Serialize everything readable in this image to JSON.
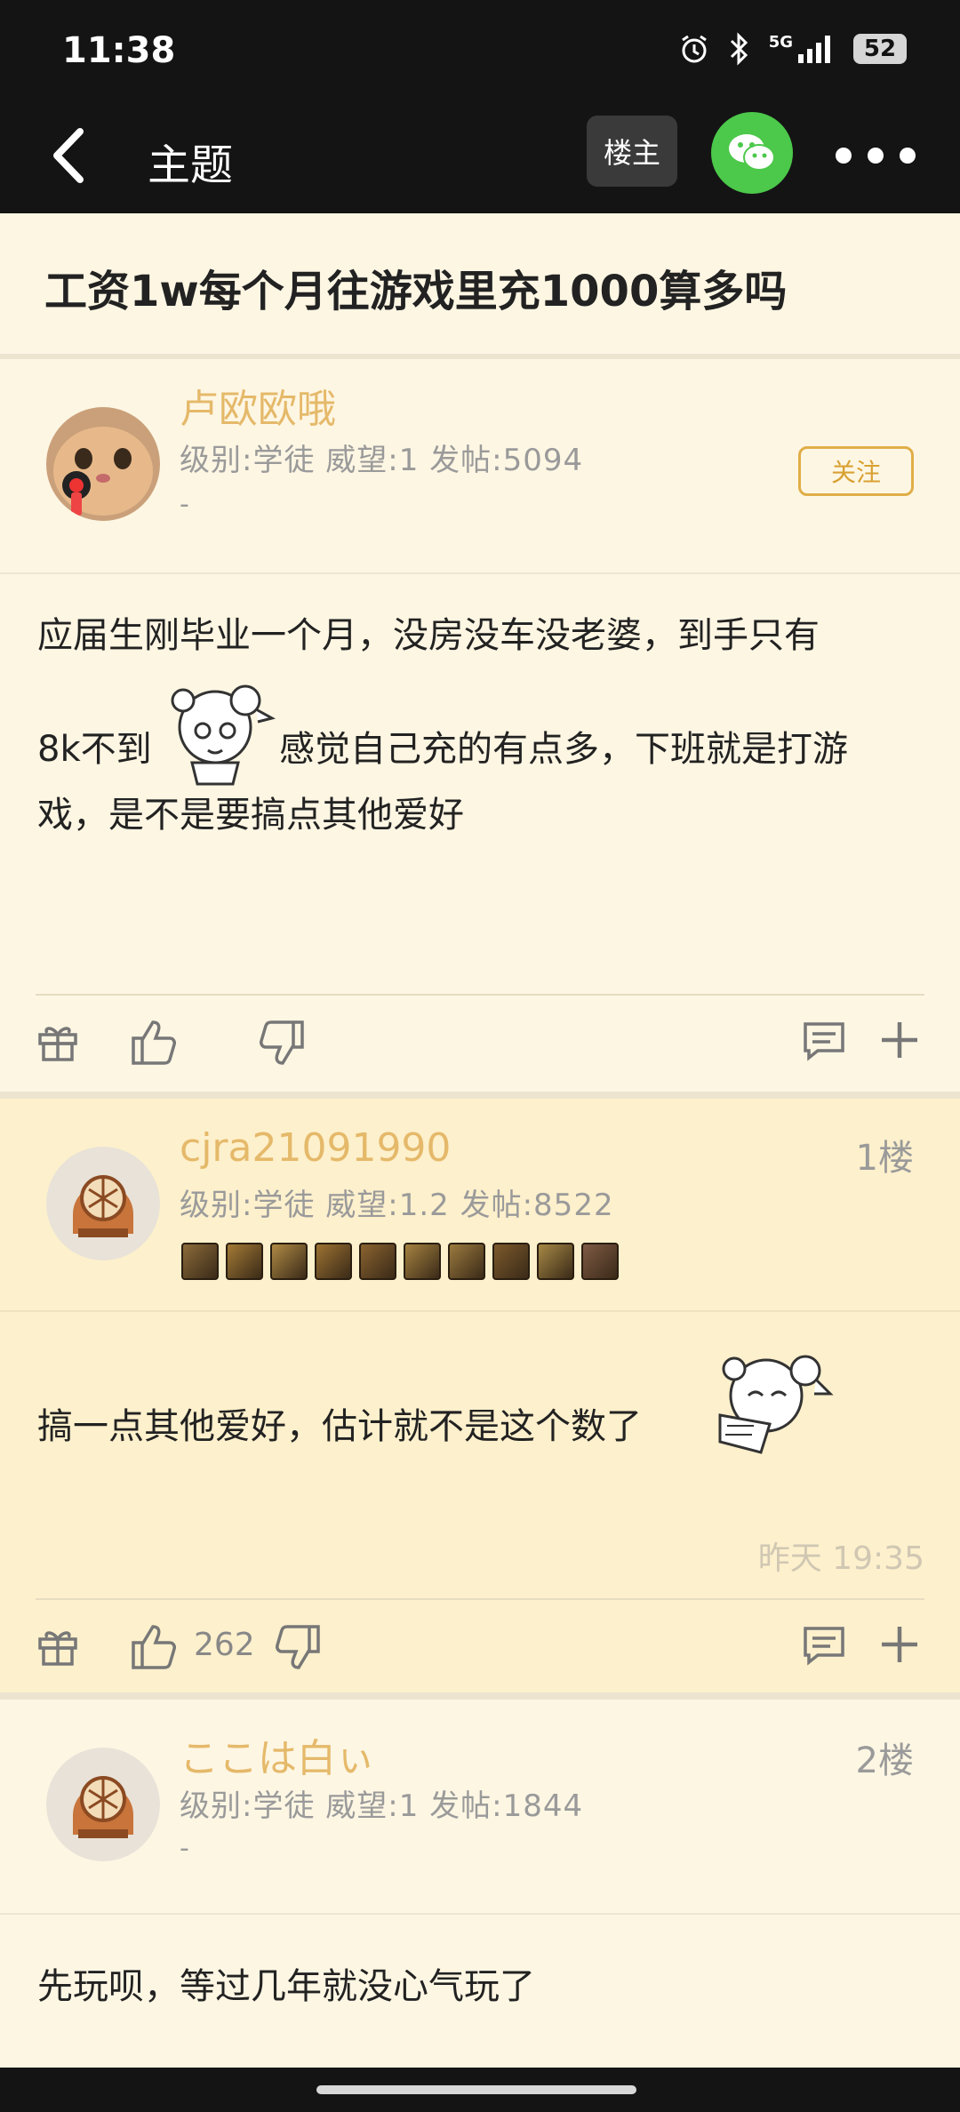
{
  "status_bar": {
    "time": "11:38",
    "battery": "52",
    "network": "5G"
  },
  "nav": {
    "title": "主题",
    "op_button": "楼主"
  },
  "thread": {
    "title": "工资1w每个月往游戏里充1000算多吗"
  },
  "op_post": {
    "username": "卢欧欧哦",
    "info": "级别:学徒 威望:1 发帖:5094",
    "dash": "-",
    "follow_label": "关注",
    "content_line1": "应届生刚毕业一个月，没房没车没老婆，到手只有",
    "content_line2a": "8k不到",
    "content_line2b": "感觉自己充的有点多，下班就是打游",
    "content_line3": "戏，是不是要搞点其他爱好"
  },
  "reply1": {
    "username": "cjra21091990",
    "floor": "1楼",
    "info": "级别:学徒 威望:1.2 发帖:8522",
    "content": "搞一点其他爱好，估计就不是这个数了",
    "timestamp": "昨天 19:35",
    "like_count": "262",
    "medal_colors": [
      "#8b6b3a",
      "#a37a35",
      "#b08a45",
      "#9c7232",
      "#8a6330",
      "#a58240",
      "#9b7a3e",
      "#7c5a2c",
      "#a68845",
      "#7f5a45"
    ]
  },
  "reply2": {
    "username": "ここは白ぃ",
    "floor": "2楼",
    "info": "级别:学徒 威望:1 发帖:1844",
    "dash": "-",
    "content": "先玩呗，等过几年就没心气玩了"
  },
  "colors": {
    "accent": "#e5b96a",
    "background": "#fdf6e3",
    "reply_bg": "#fdf0cc",
    "dark_bar": "#141414",
    "wechat": "#4cc84a"
  }
}
